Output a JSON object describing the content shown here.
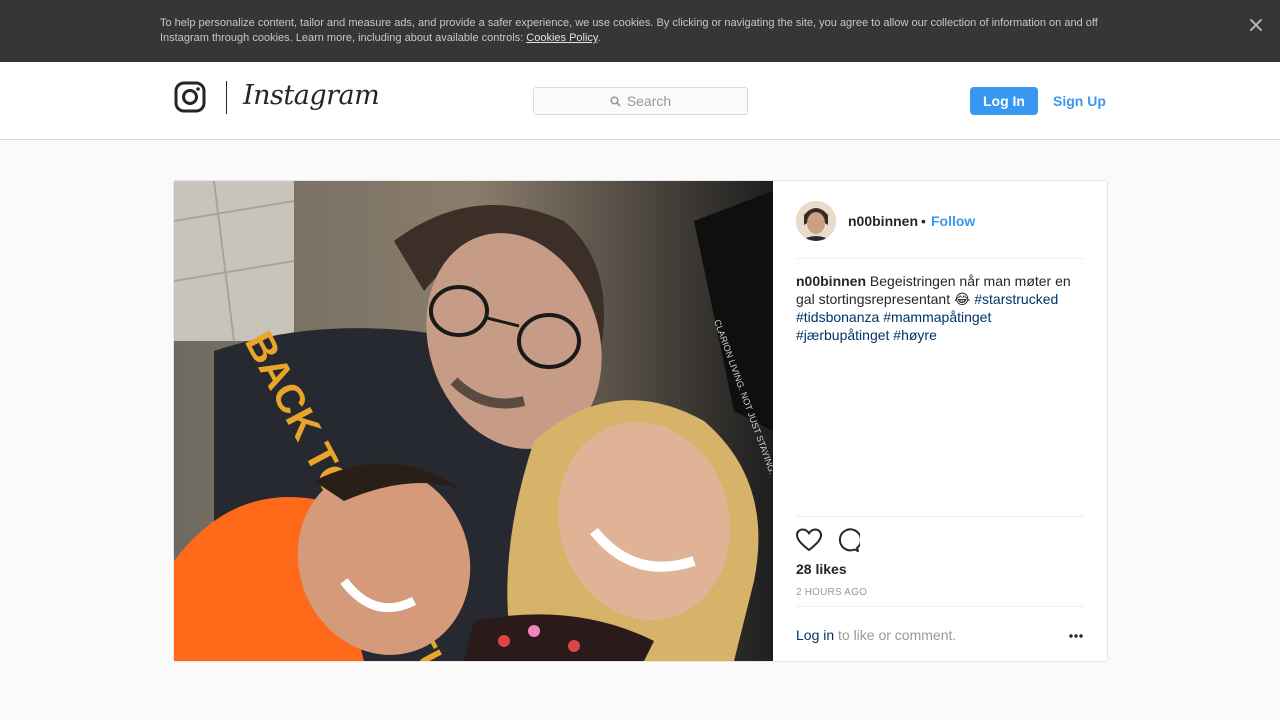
{
  "cookie_banner": {
    "text": "To help personalize content, tailor and measure ads, and provide a safer experience, we use cookies. By clicking or navigating the site, you agree to allow our collection of information on and off Instagram through cookies. Learn more, including about available controls: ",
    "link": "Cookies Policy",
    "close_icon": "close-icon"
  },
  "header": {
    "logo_word": "Instagram",
    "logo_icon": "instagram-camera-icon",
    "search_placeholder": "Search",
    "login_label": "Log In",
    "signup_label": "Sign Up",
    "accent_color": "#3897f0"
  },
  "post": {
    "username": "n00binnen",
    "separator": "•",
    "follow_label": "Follow",
    "caption_user": "n00binnen",
    "caption_text": "Begeistringen når man møter en gal stortingsrepresentant 😂",
    "hashtags": [
      "#starstrucked",
      "#tidsbonanza",
      "#mammapåtinget",
      "#jærbupåtinget",
      "#høyre"
    ],
    "likes": "28 likes",
    "time": "2 HOURS AGO",
    "login_link": "Log in",
    "login_rest": "to like or comment.",
    "photo_text_shirt": "BACK TO THE FUTURE",
    "photo_text_bag": "CLARION LIVING. NOT JUST STAYING."
  }
}
